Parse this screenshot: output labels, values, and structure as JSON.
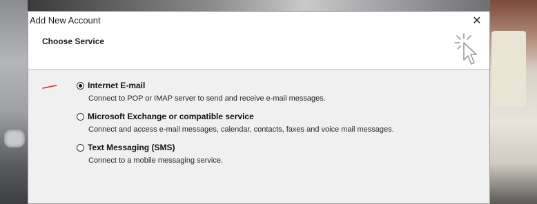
{
  "window": {
    "title": "Add New Account",
    "close_symbol": "✕"
  },
  "header": {
    "title": "Choose Service",
    "icon": "wizard-cursor-icon"
  },
  "options": [
    {
      "label": "Internet E-mail",
      "description": "Connect to POP or IMAP server to send and receive e-mail messages.",
      "selected": true
    },
    {
      "label": "Microsoft Exchange or compatible service",
      "description": "Connect and access e-mail messages, calendar, contacts, faxes and voice mail messages.",
      "selected": false
    },
    {
      "label": "Text Messaging (SMS)",
      "description": "Connect to a mobile messaging service.",
      "selected": false
    }
  ],
  "colors": {
    "annotation": "#e02020",
    "header_bg": "#ffffff",
    "body_bg": "#f0f0f0"
  }
}
